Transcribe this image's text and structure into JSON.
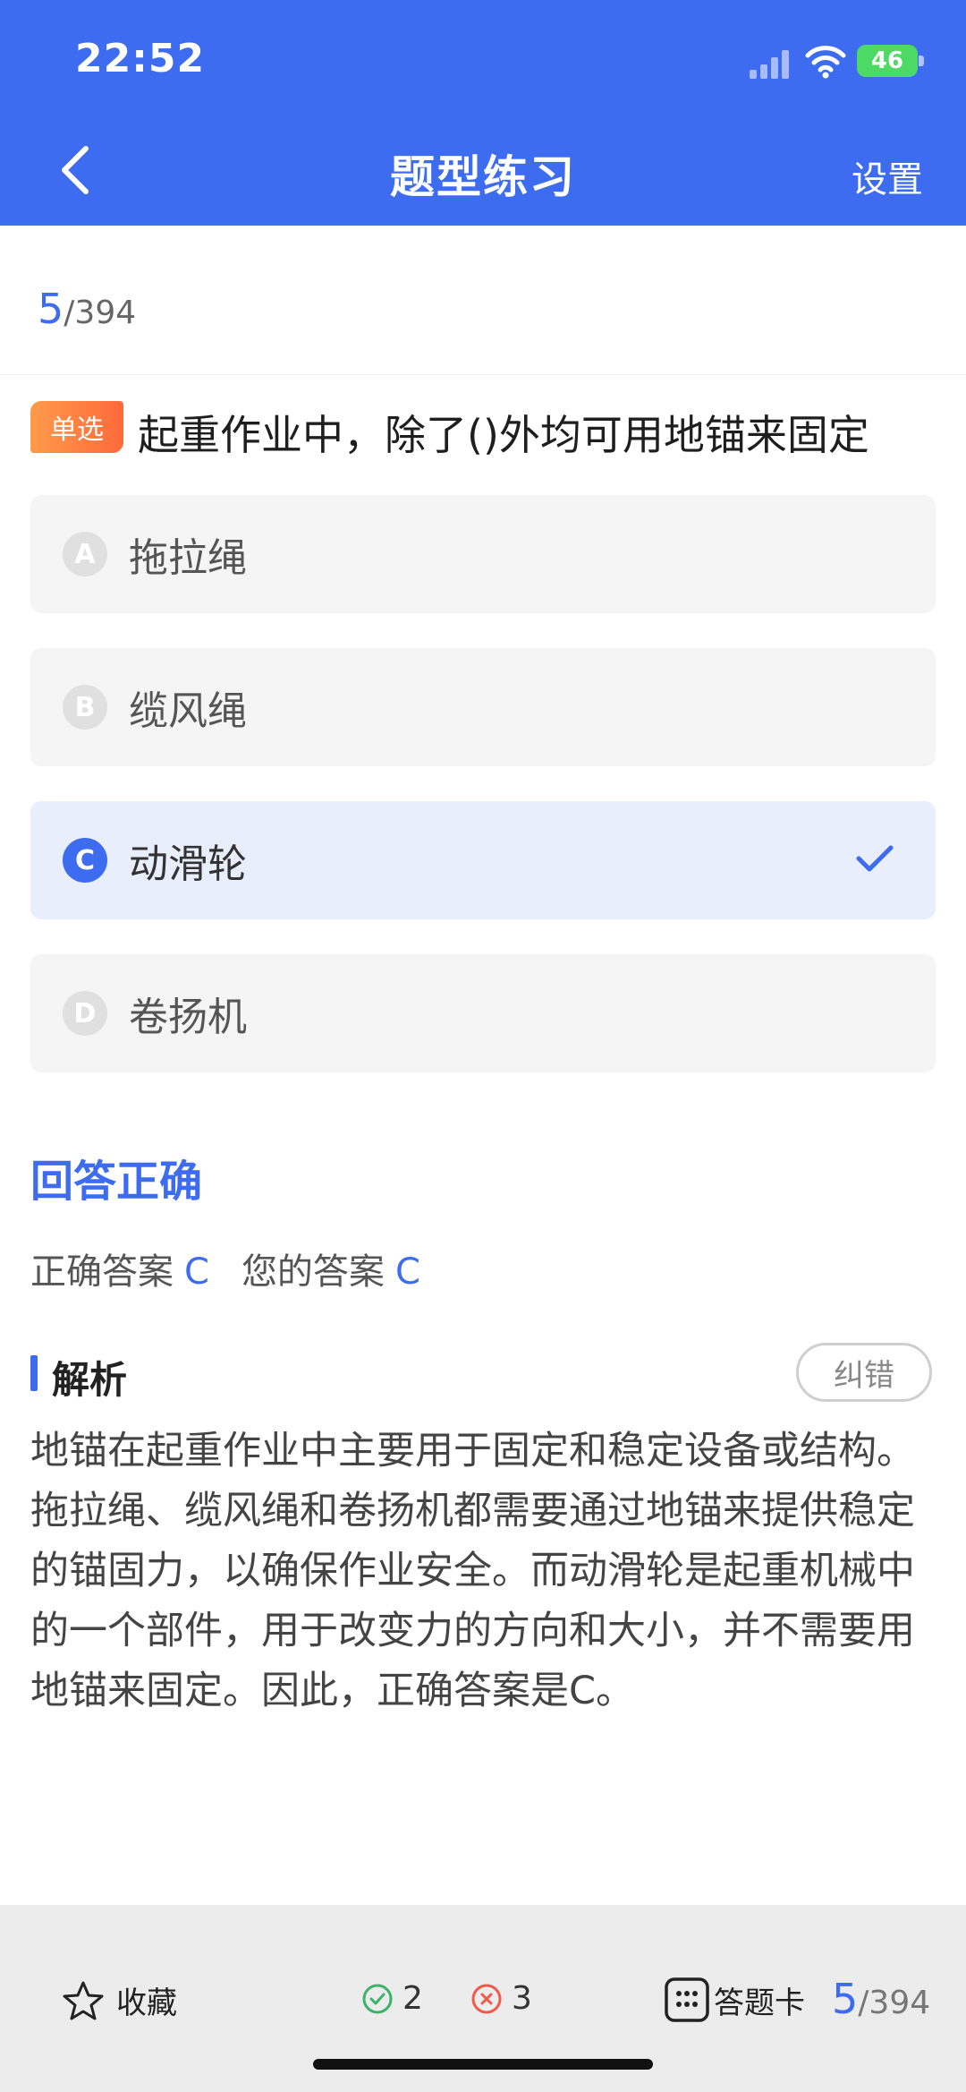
{
  "status_bar": {
    "time": "22:52",
    "battery": "46"
  },
  "header": {
    "title": "题型练习",
    "settings_label": "设置"
  },
  "progress": {
    "current": "5",
    "total": "/394"
  },
  "question": {
    "type_tag": "单选",
    "text": "起重作业中，除了()外均可用地锚来固定",
    "options": [
      {
        "letter": "A",
        "text": "拖拉绳",
        "selected": false
      },
      {
        "letter": "B",
        "text": "缆风绳",
        "selected": false
      },
      {
        "letter": "C",
        "text": "动滑轮",
        "selected": true
      },
      {
        "letter": "D",
        "text": "卷扬机",
        "selected": false
      }
    ]
  },
  "result": {
    "status": "回答正确",
    "correct_label": "正确答案",
    "correct_value": "C",
    "yours_label": "您的答案",
    "yours_value": "C"
  },
  "analysis": {
    "title": "解析",
    "report_label": "纠错",
    "text": "地锚在起重作业中主要用于固定和稳定设备或结构。拖拉绳、缆风绳和卷扬机都需要通过地锚来提供稳定的锚固力，以确保作业安全。而动滑轮是起重机械中的一个部件，用于改变力的方向和大小，并不需要用地锚来固定。因此，正确答案是C。"
  },
  "bottom_bar": {
    "favorite_label": "收藏",
    "correct_count": "2",
    "wrong_count": "3",
    "answer_card_label": "答题卡",
    "current": "5",
    "total": "/394"
  },
  "colors": {
    "accent": "#3d6cf0",
    "correct": "#3bb36b",
    "wrong": "#f05a4a",
    "tag": "#ff7a3a"
  }
}
